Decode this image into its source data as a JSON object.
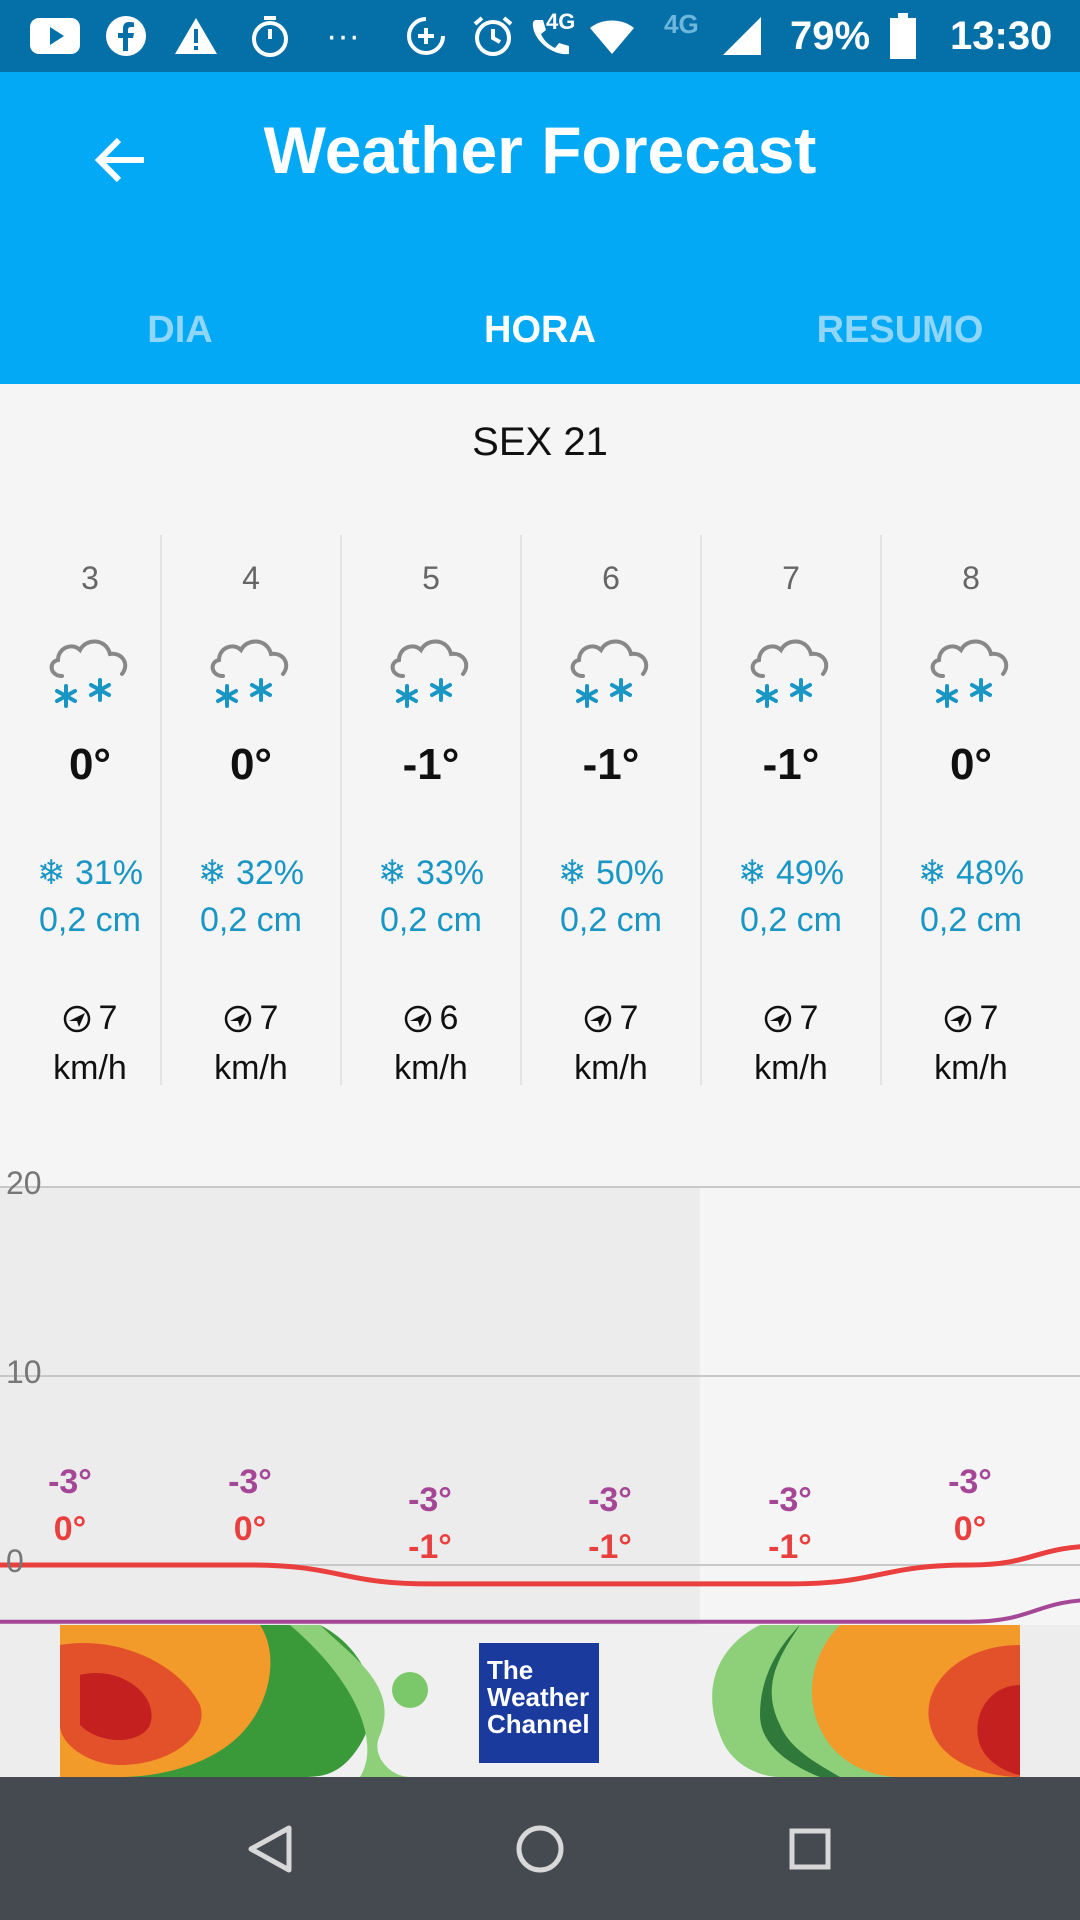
{
  "status_bar": {
    "battery": "79%",
    "time": "13:30",
    "network_a": "4G",
    "network_b": "4G",
    "more_dots": "···"
  },
  "header": {
    "title": "Weather Forecast",
    "tabs": [
      {
        "label": "DIA",
        "active": false
      },
      {
        "label": "HORA",
        "active": true
      },
      {
        "label": "RESUMO",
        "active": false
      }
    ]
  },
  "day_label": "SEX 21",
  "hours": [
    {
      "hour": "3",
      "icon": "snow-cloud-icon",
      "temp": "0°",
      "precip_chance": "31%",
      "precip_amount": "0,2 cm",
      "wind_speed": "7",
      "wind_unit": "km/h"
    },
    {
      "hour": "4",
      "icon": "snow-cloud-icon",
      "temp": "0°",
      "precip_chance": "32%",
      "precip_amount": "0,2 cm",
      "wind_speed": "7",
      "wind_unit": "km/h"
    },
    {
      "hour": "5",
      "icon": "snow-cloud-icon",
      "temp": "-1°",
      "precip_chance": "33%",
      "precip_amount": "0,2 cm",
      "wind_speed": "6",
      "wind_unit": "km/h"
    },
    {
      "hour": "6",
      "icon": "snow-cloud-icon",
      "temp": "-1°",
      "precip_chance": "50%",
      "precip_amount": "0,2 cm",
      "wind_speed": "7",
      "wind_unit": "km/h"
    },
    {
      "hour": "7",
      "icon": "snow-cloud-icon",
      "temp": "-1°",
      "precip_chance": "49%",
      "precip_amount": "0,2 cm",
      "wind_speed": "7",
      "wind_unit": "km/h"
    },
    {
      "hour": "8",
      "icon": "snow-cloud-icon",
      "temp": "0°",
      "precip_chance": "48%",
      "precip_amount": "0,2 cm",
      "wind_speed": "7",
      "wind_unit": "km/h"
    }
  ],
  "chart": {
    "y_ticks": [
      "20",
      "10",
      "0"
    ],
    "feels_like": [
      "-3°",
      "-3°",
      "-3°",
      "-3°",
      "-3°",
      "-3°"
    ],
    "temperature": [
      "0°",
      "0°",
      "-1°",
      "-1°",
      "-1°",
      "0°"
    ]
  },
  "chart_data": {
    "type": "line",
    "title": "",
    "xlabel": "",
    "ylabel": "",
    "categories": [
      "3",
      "4",
      "5",
      "6",
      "7",
      "8"
    ],
    "ylim": [
      0,
      20
    ],
    "y_ticks": [
      0,
      10,
      20
    ],
    "grid": true,
    "series": [
      {
        "values": [
          0,
          0,
          -1,
          -1,
          -1,
          0
        ],
        "color": "#ea3f3f"
      },
      {
        "values": [
          -3,
          -3,
          -3,
          -3,
          -3,
          -3
        ],
        "color": "#a54796"
      }
    ]
  },
  "ad": {
    "logo_line1": "The",
    "logo_line2": "Weather",
    "logo_line3": "Channel"
  },
  "colors": {
    "status_bar": "#0570a8",
    "app_bar": "#03a9f4",
    "precip": "#1a96c4",
    "temp_line": "#ea3f3f",
    "feels_like_line": "#a54796"
  }
}
